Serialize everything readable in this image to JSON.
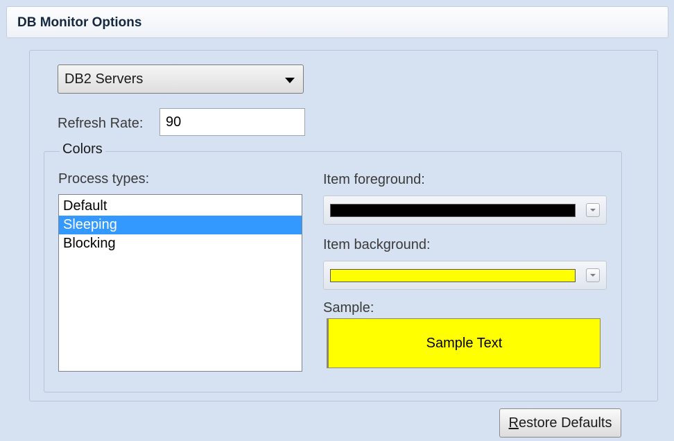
{
  "header": {
    "title": "DB Monitor Options"
  },
  "server_select": {
    "value": "DB2 Servers"
  },
  "refresh": {
    "label": "Refresh Rate:",
    "value": "90"
  },
  "colors": {
    "legend": "Colors",
    "process_types_label": "Process types:",
    "process_types": [
      {
        "label": "Default",
        "selected": false
      },
      {
        "label": "Sleeping",
        "selected": true
      },
      {
        "label": "Blocking",
        "selected": false
      }
    ],
    "foreground": {
      "label": "Item foreground:",
      "color": "#000000"
    },
    "background": {
      "label": "Item background:",
      "color": "#ffff00"
    },
    "sample": {
      "label": "Sample:",
      "text": "Sample Text"
    }
  },
  "restore": {
    "accel": "R",
    "rest": "estore Defaults"
  }
}
